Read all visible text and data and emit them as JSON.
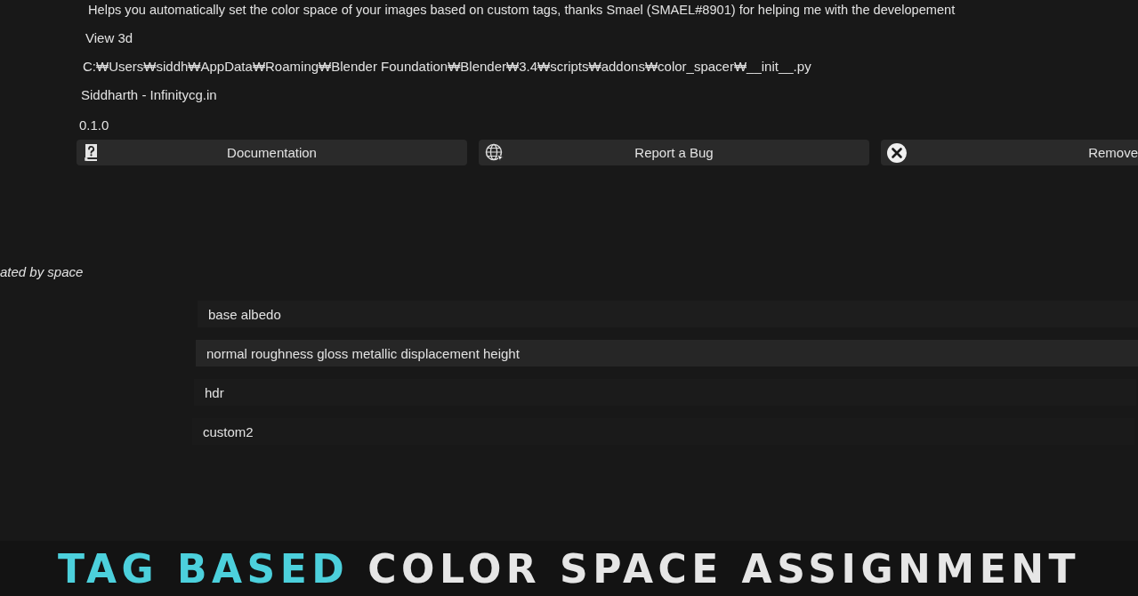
{
  "info_lines": [
    {
      "text": "Helps you automatically set the color space of your images based on custom tags, thanks Smael (SMAEL#8901) for helping me with the developement"
    },
    {
      "text": "View 3d"
    },
    {
      "text": "C:₩Users₩siddh₩AppData₩Roaming₩Blender Foundation₩Blender₩3.4₩scripts₩addons₩color_spacer₩__init__.py"
    },
    {
      "text": "Siddharth - Infinitycg.in"
    },
    {
      "text": "0.1.0"
    }
  ],
  "buttons": [
    {
      "label": "Documentation",
      "kind": "help"
    },
    {
      "label": "Report a Bug",
      "kind": "web"
    },
    {
      "label": "Remove",
      "kind": "remove"
    }
  ],
  "section_label": "ated by space",
  "tag_fields": [
    {
      "value": "base albedo"
    },
    {
      "value": "normal roughness gloss metallic displacement height"
    },
    {
      "value": "hdr"
    },
    {
      "value": "custom2"
    }
  ],
  "caption": [
    {
      "text": "TAG BASED",
      "highlight": true
    },
    {
      "text": "COLOR SPACE ASSIGNMENT",
      "highlight": false
    }
  ]
}
